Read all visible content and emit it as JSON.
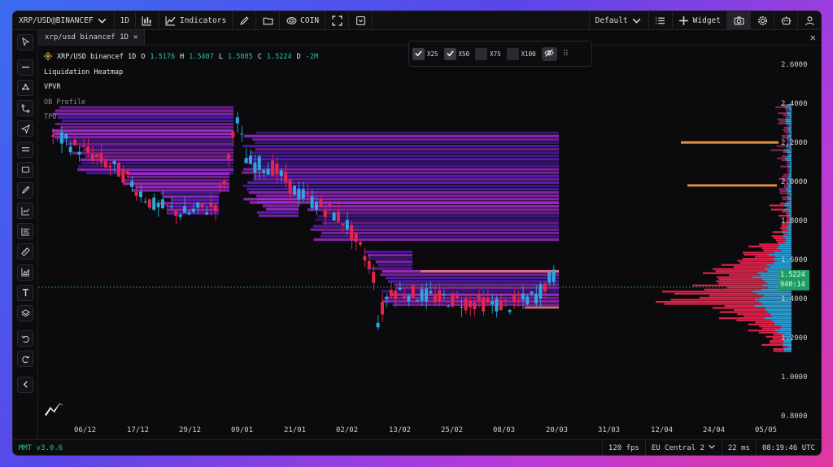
{
  "toolbar": {
    "symbol": "XRP/USD@BINANCEF",
    "interval": "1D",
    "indicators_label": "Indicators",
    "coin_label": "COIN",
    "layout_label": "Default",
    "widget_label": "Widget",
    "icons": [
      "chevron-down-icon",
      "candles-icon",
      "indicators-icon",
      "pencil-icon",
      "folder-icon",
      "coin-icon",
      "fullscreen-icon",
      "save-icon",
      "list-icon",
      "plus-icon",
      "camera-icon",
      "gear-icon",
      "robot-icon",
      "user-icon"
    ]
  },
  "tab": {
    "label": "xrp/usd binancef 1D"
  },
  "legend": {
    "title": "XRP/USD binancef 1D",
    "o_label": "O",
    "o": "1.5176",
    "h_label": "H",
    "h": "1.5407",
    "l_label": "L",
    "l": "1.5085",
    "c_label": "C",
    "c": "1.5224",
    "d_label": "D",
    "d": "-2M",
    "indicators": [
      "Liquidation Heatmap",
      "VPVR",
      "OB Profile",
      "TPO"
    ]
  },
  "multipliers": [
    {
      "label": "X25",
      "checked": true
    },
    {
      "label": "X50",
      "checked": true
    },
    {
      "label": "X75",
      "checked": false
    },
    {
      "label": "X100",
      "checked": false
    }
  ],
  "price_axis": [
    "2.6000",
    "2.4000",
    "2.2000",
    "2.0000",
    "1.8000",
    "1.6000",
    "1.4000",
    "1.2000",
    "1.0000",
    "0.8000"
  ],
  "price_tag": {
    "price": "1.5224",
    "countdown": "940:14"
  },
  "time_axis": [
    "06/12",
    "17/12",
    "29/12",
    "09/01",
    "21/01",
    "02/02",
    "13/02",
    "25/02",
    "08/03",
    "20/03",
    "31/03",
    "12/04",
    "24/04",
    "05/05"
  ],
  "status": {
    "version": "MMT v3.0.6",
    "fps": "120 fps",
    "region": "EU Central 2",
    "latency": "22 ms",
    "clock": "08:19:46 UTC"
  },
  "colors": {
    "up": "#2ea7e0",
    "down": "#e8244d",
    "heat_high": "#f29a4a",
    "heat_mid": "#a72bd6",
    "heat_low": "#5a1fc4",
    "price_tag": "#1f9d64"
  }
}
